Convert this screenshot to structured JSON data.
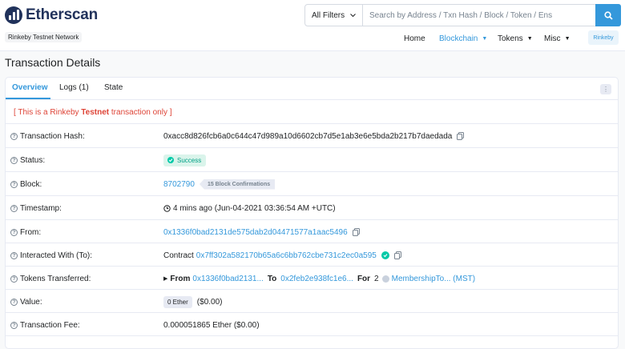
{
  "brand": {
    "name": "Etherscan",
    "network": "Rinkeby Testnet Network"
  },
  "search": {
    "filter": "All Filters",
    "placeholder": "Search by Address / Txn Hash / Block / Token / Ens"
  },
  "nav": {
    "home": "Home",
    "blockchain": "Blockchain",
    "tokens": "Tokens",
    "misc": "Misc",
    "network_button": "Rinkeby"
  },
  "page_title": "Transaction Details",
  "tabs": {
    "overview": "Overview",
    "logs": "Logs (1)",
    "state": "State"
  },
  "notice": {
    "prefix": "[ This is a Rinkeby ",
    "highlight": "Testnet",
    "suffix": " transaction only ]"
  },
  "rows": {
    "hash": {
      "label": "Transaction Hash:",
      "value": "0xacc8d826fcb6a0c644c47d989a10d6602cb7d5e1ab3e6e5bda2b217b7daedada"
    },
    "status": {
      "label": "Status:",
      "value": "Success"
    },
    "block": {
      "label": "Block:",
      "number": "8702790",
      "confirmations": "15 Block Confirmations"
    },
    "timestamp": {
      "label": "Timestamp:",
      "value": "4 mins ago (Jun-04-2021 03:36:54 AM +UTC)"
    },
    "from": {
      "label": "From:",
      "value": "0x1336f0bad2131de575dab2d04471577a1aac5496"
    },
    "interacted": {
      "label": "Interacted With (To):",
      "prefix": "Contract",
      "value": "0x7ff302a582170b65a6c6bb762cbe731c2ec0a595"
    },
    "tokens": {
      "label": "Tokens Transferred:",
      "from_label": "From",
      "from_value": "0x1336f0bad2131...",
      "to_label": "To",
      "to_value": "0x2feb2e938fc1e6...",
      "for_label": "For",
      "amount": "2",
      "token_name": "MembershipTo... (MST)"
    },
    "value": {
      "label": "Value:",
      "ether": "0 Ether",
      "usd": "($0.00)"
    },
    "fee": {
      "label": "Transaction Fee:",
      "value": "0.000051865 Ether ($0.00)"
    }
  },
  "colors": {
    "accent": "#3498db",
    "brand": "#21325b",
    "success": "#00c9a7",
    "danger": "#de4437"
  }
}
